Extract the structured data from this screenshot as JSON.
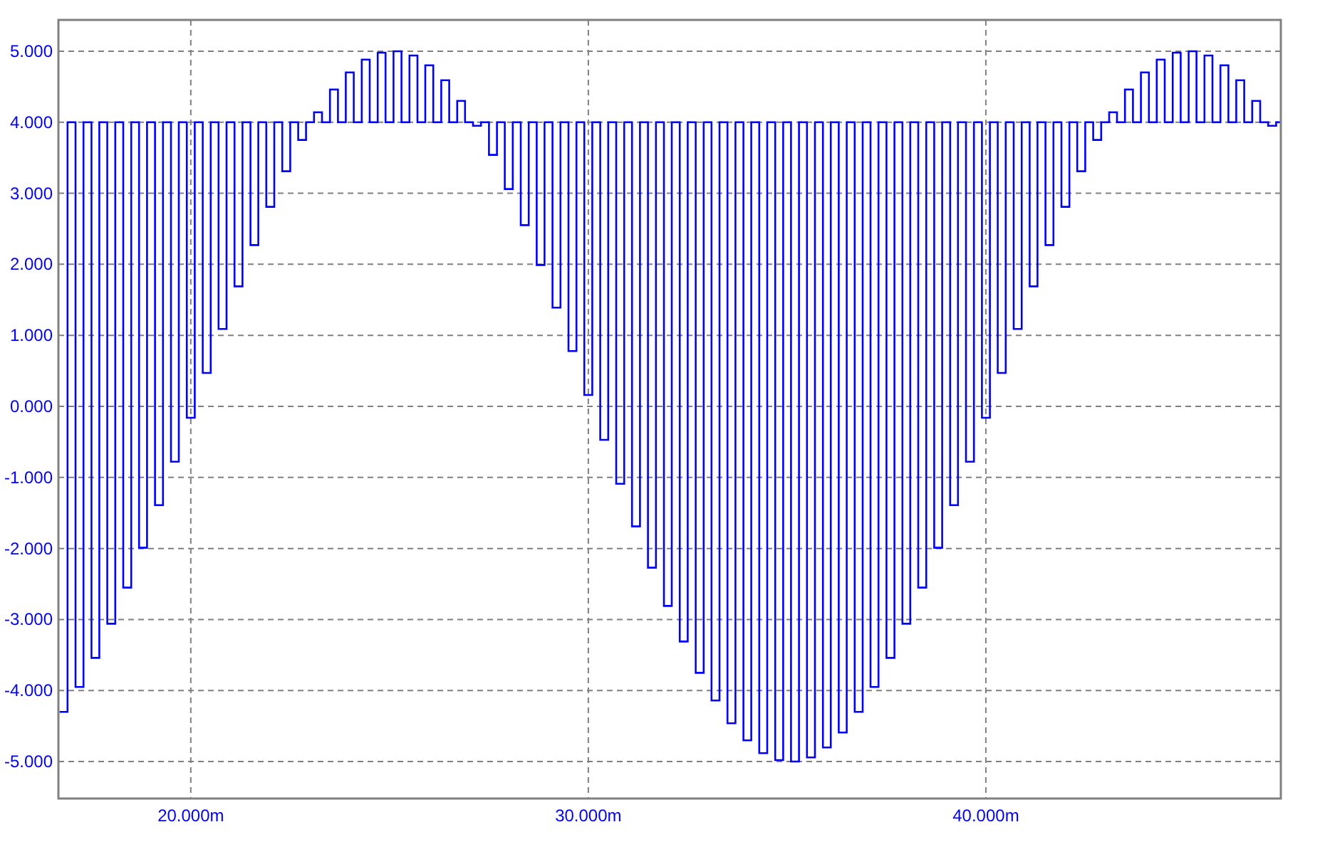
{
  "chart_data": {
    "type": "line",
    "grid": true,
    "xlim": [
      16.67,
      47.42
    ],
    "ylim": [
      -5.52,
      5.44
    ],
    "xticks": [
      {
        "value": 20,
        "label": "20.000m"
      },
      {
        "value": 30,
        "label": "30.000m"
      },
      {
        "value": 40,
        "label": "40.000m"
      }
    ],
    "yticks": [
      {
        "value": 5,
        "label": "5.000"
      },
      {
        "value": 4,
        "label": "4.000"
      },
      {
        "value": 3,
        "label": "3.000"
      },
      {
        "value": 2,
        "label": "2.000"
      },
      {
        "value": 1,
        "label": "1.000"
      },
      {
        "value": 0,
        "label": "0.000"
      },
      {
        "value": -1,
        "label": "-1.000"
      },
      {
        "value": -2,
        "label": "-2.000"
      },
      {
        "value": -3,
        "label": "-3.000"
      },
      {
        "value": -4,
        "label": "-4.000"
      },
      {
        "value": -5,
        "label": "-5.000"
      }
    ],
    "x": [
      16.7,
      16.9,
      16.9,
      17.1,
      17.1,
      17.3,
      17.3,
      17.5,
      17.5,
      17.7,
      17.7,
      17.9,
      17.9,
      18.1,
      18.1,
      18.3,
      18.3,
      18.5,
      18.5,
      18.7,
      18.7,
      18.9,
      18.9,
      19.1,
      19.1,
      19.3,
      19.3,
      19.5,
      19.5,
      19.7,
      19.7,
      19.9,
      19.9,
      20.1,
      20.1,
      20.3,
      20.3,
      20.5,
      20.5,
      20.7,
      20.7,
      20.9,
      20.9,
      21.1,
      21.1,
      21.3,
      21.3,
      21.5,
      21.5,
      21.7,
      21.7,
      21.9,
      21.9,
      22.1,
      22.1,
      22.3,
      22.3,
      22.5,
      22.5,
      22.7,
      22.7,
      22.9,
      22.9,
      23.1,
      23.1,
      23.3,
      23.3,
      23.5,
      23.5,
      23.7,
      23.7,
      23.9,
      23.9,
      24.1,
      24.1,
      24.3,
      24.3,
      24.5,
      24.5,
      24.7,
      24.7,
      24.9,
      24.9,
      25.1,
      25.1,
      25.3,
      25.3,
      25.5,
      25.5,
      25.7,
      25.7,
      25.9,
      25.9,
      26.1,
      26.1,
      26.3,
      26.3,
      26.5,
      26.5,
      26.7,
      26.7,
      26.9,
      26.9,
      27.1,
      27.1,
      27.3,
      27.3,
      27.5,
      27.5,
      27.7,
      27.7,
      27.9,
      27.9,
      28.1,
      28.1,
      28.3,
      28.3,
      28.5,
      28.5,
      28.7,
      28.7,
      28.9,
      28.9,
      29.1,
      29.1,
      29.3,
      29.3,
      29.5,
      29.5,
      29.7,
      29.7,
      29.9,
      29.9,
      30.1,
      30.1,
      30.3,
      30.3,
      30.5,
      30.5,
      30.7,
      30.7,
      30.9,
      30.9,
      31.1,
      31.1,
      31.3,
      31.3,
      31.5,
      31.5,
      31.7,
      31.7,
      31.9,
      31.9,
      32.1,
      32.1,
      32.3,
      32.3,
      32.5,
      32.5,
      32.7,
      32.7,
      32.9,
      32.9,
      33.1,
      33.1,
      33.3,
      33.3,
      33.5,
      33.5,
      33.7,
      33.7,
      33.9,
      33.9,
      34.1,
      34.1,
      34.3,
      34.3,
      34.5,
      34.5,
      34.7,
      34.7,
      34.9,
      34.9,
      35.1,
      35.1,
      35.3,
      35.3,
      35.5,
      35.5,
      35.7,
      35.7,
      35.9,
      35.9,
      36.1,
      36.1,
      36.3,
      36.3,
      36.5,
      36.5,
      36.7,
      36.7,
      36.9,
      36.9,
      37.1,
      37.1,
      37.3,
      37.3,
      37.5,
      37.5,
      37.7,
      37.7,
      37.9,
      37.9,
      38.1,
      38.1,
      38.3,
      38.3,
      38.5,
      38.5,
      38.7,
      38.7,
      38.9,
      38.9,
      39.1,
      39.1,
      39.3,
      39.3,
      39.5,
      39.5,
      39.7,
      39.7,
      39.9,
      39.9,
      40.1,
      40.1,
      40.3,
      40.3,
      40.5,
      40.5,
      40.7,
      40.7,
      40.9,
      40.9,
      41.1,
      41.1,
      41.3,
      41.3,
      41.5,
      41.5,
      41.7,
      41.7,
      41.9,
      41.9,
      42.1,
      42.1,
      42.3,
      42.3,
      42.5,
      42.5,
      42.7,
      42.7,
      42.9,
      42.9,
      43.1,
      43.1,
      43.3,
      43.3,
      43.5,
      43.5,
      43.7,
      43.7,
      43.9,
      43.9,
      44.1,
      44.1,
      44.3,
      44.3,
      44.5,
      44.5,
      44.7,
      44.7,
      44.9,
      44.9,
      45.1,
      45.1,
      45.3,
      45.3,
      45.5,
      45.5,
      45.7,
      45.7,
      45.9,
      45.9,
      46.1,
      46.1,
      46.3,
      46.3,
      46.5,
      46.5,
      46.7,
      46.7,
      46.9,
      46.9,
      47.1,
      47.1,
      47.3,
      47.3,
      47.42
    ],
    "series": [
      {
        "color": "#0000ff",
        "values": [
          -4.3,
          -4.3,
          4,
          4,
          -3.95,
          -3.95,
          4,
          4,
          -3.54,
          -3.54,
          4,
          4,
          -3.06,
          -3.06,
          4,
          4,
          -2.55,
          -2.55,
          4,
          4,
          -1.99,
          -1.99,
          4,
          4,
          -1.39,
          -1.39,
          4,
          4,
          -0.78,
          -0.78,
          4,
          4,
          -0.16,
          -0.16,
          4,
          4,
          0.47,
          0.47,
          4,
          4,
          1.09,
          1.09,
          4,
          4,
          1.69,
          1.69,
          4,
          4,
          2.27,
          2.27,
          4,
          4,
          2.81,
          2.81,
          4,
          4,
          3.31,
          3.31,
          4,
          4,
          3.75,
          3.75,
          4,
          4,
          4.14,
          4.14,
          4,
          4,
          4.46,
          4.46,
          4,
          4,
          4.7,
          4.7,
          4,
          4,
          4.88,
          4.88,
          4,
          4,
          4.98,
          4.98,
          4,
          4,
          5.0,
          5.0,
          4,
          4,
          4.94,
          4.94,
          4,
          4,
          4.8,
          4.8,
          4,
          4,
          4.59,
          4.59,
          4,
          4,
          4.3,
          4.3,
          4,
          4,
          3.95,
          3.95,
          4,
          4,
          3.54,
          3.54,
          4,
          4,
          3.06,
          3.06,
          4,
          4,
          2.55,
          2.55,
          4,
          4,
          1.99,
          1.99,
          4,
          4,
          1.39,
          1.39,
          4,
          4,
          0.78,
          0.78,
          4,
          4,
          0.16,
          0.16,
          4,
          4,
          -0.47,
          -0.47,
          4,
          4,
          -1.09,
          -1.09,
          4,
          4,
          -1.69,
          -1.69,
          4,
          4,
          -2.27,
          -2.27,
          4,
          4,
          -2.81,
          -2.81,
          4,
          4,
          -3.31,
          -3.31,
          4,
          4,
          -3.75,
          -3.75,
          4,
          4,
          -4.14,
          -4.14,
          4,
          4,
          -4.46,
          -4.46,
          4,
          4,
          -4.7,
          -4.7,
          4,
          4,
          -4.88,
          -4.88,
          4,
          4,
          -4.98,
          -4.98,
          4,
          4,
          -5.0,
          -5.0,
          4,
          4,
          -4.94,
          -4.94,
          4,
          4,
          -4.8,
          -4.8,
          4,
          4,
          -4.59,
          -4.59,
          4,
          4,
          -4.3,
          -4.3,
          4,
          4,
          -3.95,
          -3.95,
          4,
          4,
          -3.54,
          -3.54,
          4,
          4,
          -3.06,
          -3.06,
          4,
          4,
          -2.55,
          -2.55,
          4,
          4,
          -1.99,
          -1.99,
          4,
          4,
          -1.39,
          -1.39,
          4,
          4,
          -0.78,
          -0.78,
          4,
          4,
          -0.16,
          -0.16,
          4,
          4,
          0.47,
          0.47,
          4,
          4,
          1.09,
          1.09,
          4,
          4,
          1.69,
          1.69,
          4,
          4,
          2.27,
          2.27,
          4,
          4,
          2.81,
          2.81,
          4,
          4,
          3.31,
          3.31,
          4,
          4,
          3.75,
          3.75,
          4,
          4,
          4.14,
          4.14,
          4,
          4,
          4.46,
          4.46,
          4,
          4,
          4.7,
          4.7,
          4,
          4,
          4.88,
          4.88,
          4,
          4,
          4.98,
          4.98,
          4,
          4,
          5.0,
          5.0,
          4,
          4,
          4.94,
          4.94,
          4,
          4,
          4.8,
          4.8,
          4,
          4,
          4.59,
          4.59,
          4,
          4,
          4.3,
          4.3,
          4,
          4,
          3.95,
          3.95,
          4,
          4
        ]
      }
    ]
  }
}
